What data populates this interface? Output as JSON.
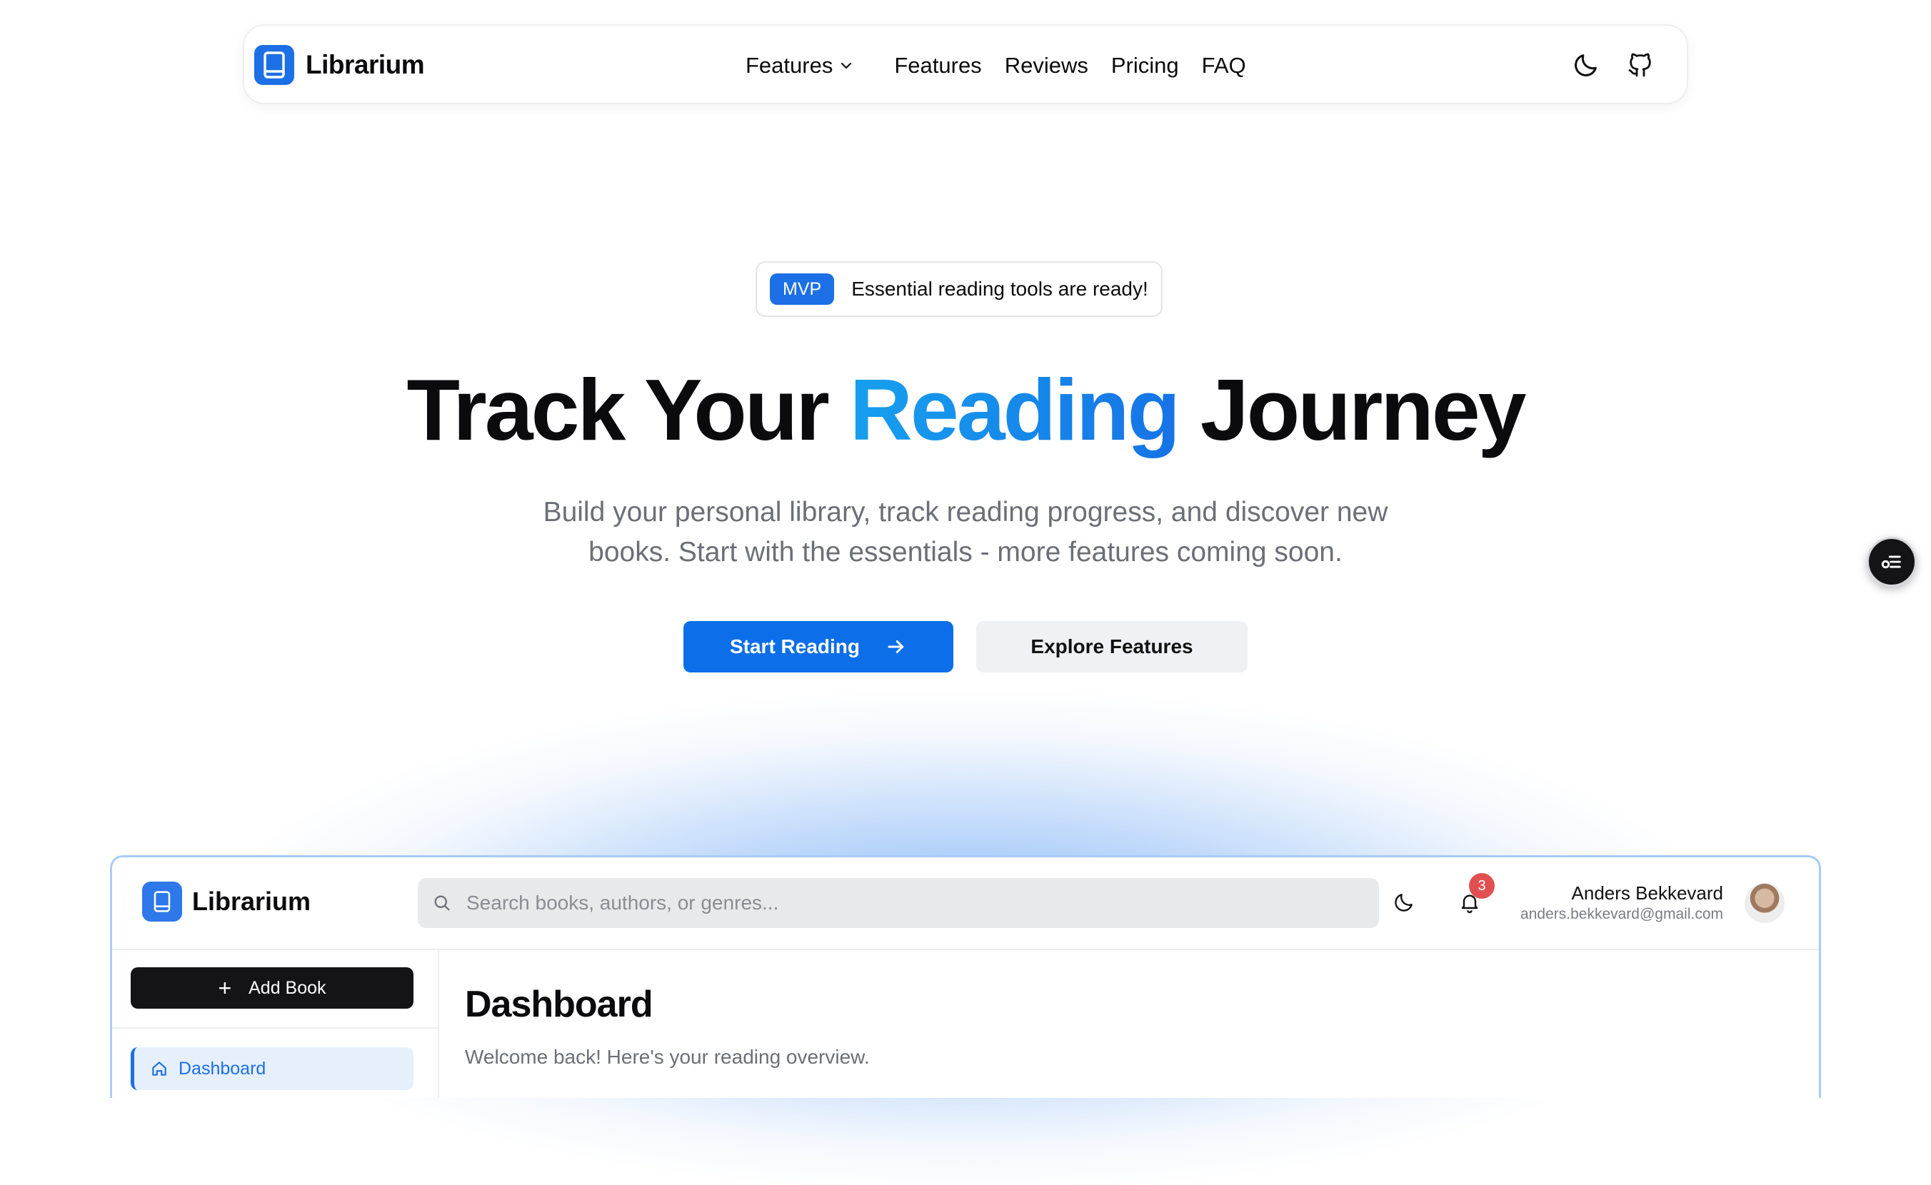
{
  "nav": {
    "brand": "Librarium",
    "links": [
      {
        "label": "Features",
        "dropdown": true
      },
      {
        "label": "Features"
      },
      {
        "label": "Reviews"
      },
      {
        "label": "Pricing"
      },
      {
        "label": "FAQ"
      }
    ],
    "icons": [
      "moon-icon",
      "github-icon"
    ]
  },
  "hero": {
    "badge_tag": "MVP",
    "badge_text": "Essential reading tools are ready!",
    "title_part1": "Track Your",
    "title_accent": "Reading",
    "title_part2": "Journey",
    "subtitle_line1": "Build your personal library, track reading progress, and discover new",
    "subtitle_line2": "books. Start with the essentials - more features coming soon.",
    "primary_cta": "Start Reading",
    "secondary_cta": "Explore Features"
  },
  "app_preview": {
    "brand": "Librarium",
    "search_placeholder": "Search books, authors, or genres...",
    "notification_count": "3",
    "user": {
      "name": "Anders Bekkevard",
      "email": "anders.bekkevard@gmail.com"
    },
    "add_book_label": "Add Book",
    "sidebar_items": [
      {
        "label": "Dashboard",
        "icon": "home-icon",
        "active": true
      }
    ],
    "page_title": "Dashboard",
    "page_subtitle": "Welcome back! Here's your reading overview."
  },
  "colors": {
    "accent": "#1d6fe6",
    "accent_gradient_start": "#16a0ee",
    "badge_red": "#e05050",
    "dark_button": "#141416"
  }
}
